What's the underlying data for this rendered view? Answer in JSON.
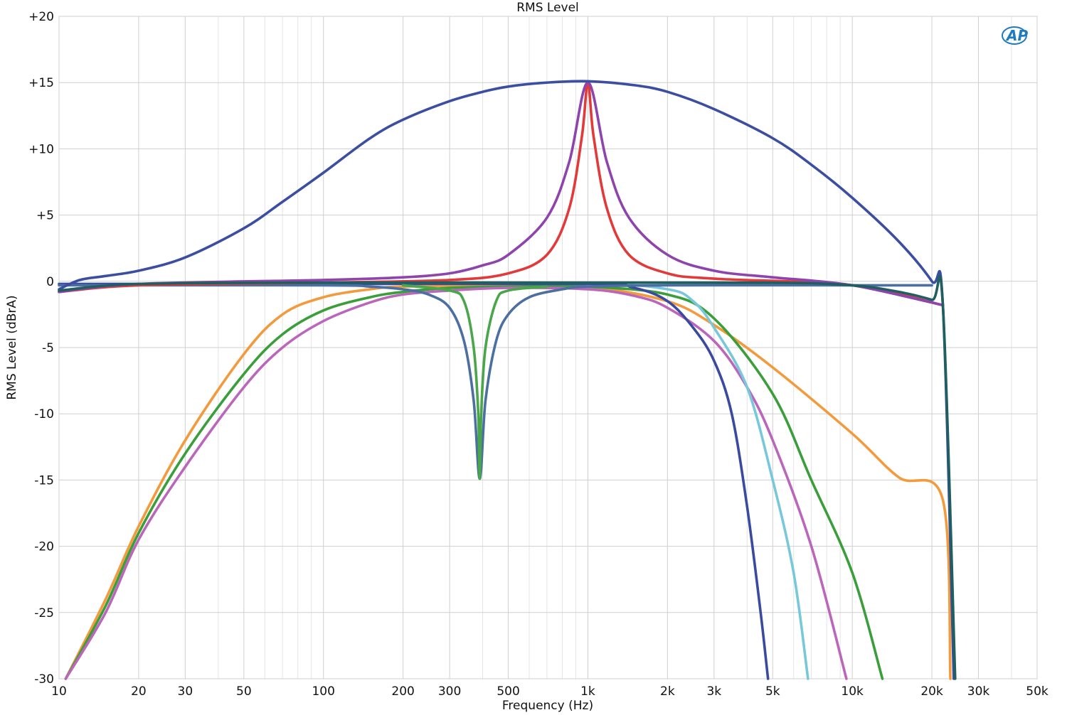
{
  "chart_data": {
    "type": "line",
    "title": "RMS Level",
    "xlabel": "Frequency (Hz)",
    "ylabel": "RMS Level (dBrA)",
    "x_scale": "log",
    "xlim": [
      10,
      50000
    ],
    "ylim": [
      -30,
      20
    ],
    "x_ticks": [
      10,
      20,
      30,
      50,
      100,
      200,
      300,
      500,
      1000,
      2000,
      3000,
      5000,
      10000,
      20000,
      30000,
      50000
    ],
    "x_tick_labels": [
      "10",
      "20",
      "30",
      "50",
      "100",
      "200",
      "300",
      "500",
      "1k",
      "2k",
      "3k",
      "5k",
      "10k",
      "20k",
      "30k",
      "50k"
    ],
    "y_ticks": [
      20,
      15,
      10,
      5,
      0,
      -5,
      -10,
      -15,
      -20,
      -25,
      -30
    ],
    "y_tick_labels": [
      "+20",
      "+15",
      "+10",
      "+5",
      "0",
      "-5",
      "-10",
      "-15",
      "-20",
      "-25",
      "-30"
    ],
    "grid": true,
    "logo": "AP",
    "series": [
      {
        "color": "#f39a3c",
        "points": [
          [
            10.6,
            -30
          ],
          [
            15,
            -24
          ],
          [
            20,
            -18.5
          ],
          [
            30,
            -12
          ],
          [
            50,
            -5.5
          ],
          [
            70,
            -2.5
          ],
          [
            100,
            -1.2
          ],
          [
            150,
            -0.6
          ],
          [
            200,
            -0.4
          ],
          [
            500,
            -0.3
          ],
          [
            1000,
            -0.4
          ],
          [
            2000,
            -1.5
          ],
          [
            3000,
            -3.3
          ],
          [
            5000,
            -6.5
          ],
          [
            10000,
            -11.5
          ],
          [
            15000,
            -14.8
          ],
          [
            22000,
            -16.5
          ],
          [
            23500,
            -30
          ]
        ]
      },
      {
        "color": "#3a9e3a",
        "points": [
          [
            10.6,
            -30
          ],
          [
            15,
            -24.5
          ],
          [
            20,
            -19
          ],
          [
            30,
            -13
          ],
          [
            50,
            -7
          ],
          [
            70,
            -4
          ],
          [
            100,
            -2.2
          ],
          [
            150,
            -1.2
          ],
          [
            200,
            -0.8
          ],
          [
            300,
            -0.5
          ],
          [
            500,
            -0.4
          ],
          [
            1000,
            -0.4
          ],
          [
            2000,
            -1
          ],
          [
            3000,
            -2.8
          ],
          [
            5000,
            -8.5
          ],
          [
            7000,
            -15
          ],
          [
            10000,
            -22
          ],
          [
            13000,
            -30
          ]
        ]
      },
      {
        "color": "#bb66bb",
        "points": [
          [
            10.6,
            -30
          ],
          [
            15,
            -25
          ],
          [
            20,
            -19.5
          ],
          [
            30,
            -14
          ],
          [
            50,
            -8
          ],
          [
            70,
            -5
          ],
          [
            100,
            -3
          ],
          [
            150,
            -1.6
          ],
          [
            200,
            -1
          ],
          [
            300,
            -0.7
          ],
          [
            500,
            -0.5
          ],
          [
            1000,
            -0.6
          ],
          [
            1500,
            -1.1
          ],
          [
            2000,
            -2
          ],
          [
            3000,
            -4.5
          ],
          [
            4000,
            -8
          ],
          [
            5000,
            -12
          ],
          [
            7000,
            -20
          ],
          [
            9500,
            -30
          ]
        ]
      },
      {
        "color": "#78c8dc",
        "points": [
          [
            10,
            -0.2
          ],
          [
            100,
            -0.2
          ],
          [
            1000,
            -0.2
          ],
          [
            2000,
            -0.6
          ],
          [
            2500,
            -1.5
          ],
          [
            3000,
            -3.5
          ],
          [
            4000,
            -8
          ],
          [
            5000,
            -15
          ],
          [
            6000,
            -22
          ],
          [
            6800,
            -30
          ]
        ]
      },
      {
        "color": "#3a4aa0",
        "points": [
          [
            10,
            -0.2
          ],
          [
            100,
            -0.2
          ],
          [
            1000,
            -0.2
          ],
          [
            1500,
            -0.5
          ],
          [
            2000,
            -1.5
          ],
          [
            2500,
            -3.5
          ],
          [
            3000,
            -6
          ],
          [
            3500,
            -10
          ],
          [
            4000,
            -17
          ],
          [
            4500,
            -25
          ],
          [
            4800,
            -30
          ]
        ]
      },
      {
        "color": "#4a6fa0",
        "points": [
          [
            10,
            -0.3
          ],
          [
            100,
            -0.3
          ],
          [
            150,
            -0.4
          ],
          [
            200,
            -0.6
          ],
          [
            250,
            -1
          ],
          [
            300,
            -2
          ],
          [
            340,
            -4.5
          ],
          [
            370,
            -9
          ],
          [
            390,
            -14.9
          ],
          [
            410,
            -9
          ],
          [
            450,
            -4.5
          ],
          [
            500,
            -2.5
          ],
          [
            600,
            -1.2
          ],
          [
            800,
            -0.6
          ],
          [
            1000,
            -0.4
          ],
          [
            2000,
            -0.3
          ],
          [
            10000,
            -0.3
          ],
          [
            20000,
            -0.3
          ]
        ]
      },
      {
        "color": "#4aa64a",
        "points": [
          [
            200,
            -0.3
          ],
          [
            300,
            -0.7
          ],
          [
            340,
            -1.5
          ],
          [
            370,
            -5
          ],
          [
            385,
            -10
          ],
          [
            390,
            -14.9
          ],
          [
            395,
            -10
          ],
          [
            410,
            -5
          ],
          [
            450,
            -1.5
          ],
          [
            500,
            -0.7
          ],
          [
            700,
            -0.4
          ]
        ]
      },
      {
        "color": "#e23a3a",
        "points": [
          [
            10,
            -0.8
          ],
          [
            20,
            -0.3
          ],
          [
            100,
            -0.1
          ],
          [
            300,
            0.1
          ],
          [
            500,
            0.6
          ],
          [
            700,
            2
          ],
          [
            850,
            5.5
          ],
          [
            950,
            11
          ],
          [
            1000,
            15
          ],
          [
            1050,
            11
          ],
          [
            1180,
            5.5
          ],
          [
            1430,
            2
          ],
          [
            2000,
            0.6
          ],
          [
            3000,
            0.2
          ],
          [
            10000,
            -0.3
          ],
          [
            22000,
            -1.8
          ]
        ]
      },
      {
        "color": "#8e44ad",
        "points": [
          [
            10,
            -0.8
          ],
          [
            20,
            -0.2
          ],
          [
            100,
            0.1
          ],
          [
            200,
            0.3
          ],
          [
            300,
            0.6
          ],
          [
            400,
            1.2
          ],
          [
            500,
            2
          ],
          [
            700,
            4.8
          ],
          [
            850,
            9
          ],
          [
            1000,
            15
          ],
          [
            1180,
            9
          ],
          [
            1430,
            4.8
          ],
          [
            2000,
            2
          ],
          [
            3000,
            0.8
          ],
          [
            5000,
            0.3
          ],
          [
            10000,
            -0.3
          ],
          [
            22000,
            -1.8
          ]
        ]
      },
      {
        "color": "#3b4ea1",
        "points": [
          [
            10,
            -0.6
          ],
          [
            12,
            0.1
          ],
          [
            15,
            0.4
          ],
          [
            20,
            0.8
          ],
          [
            30,
            1.8
          ],
          [
            50,
            4
          ],
          [
            70,
            6
          ],
          [
            100,
            8.2
          ],
          [
            150,
            10.8
          ],
          [
            200,
            12.2
          ],
          [
            300,
            13.6
          ],
          [
            400,
            14.3
          ],
          [
            500,
            14.7
          ],
          [
            700,
            15
          ],
          [
            1000,
            15.1
          ],
          [
            1500,
            14.8
          ],
          [
            2000,
            14.3
          ],
          [
            3000,
            13
          ],
          [
            5000,
            10.8
          ],
          [
            7000,
            8.8
          ],
          [
            10000,
            6.3
          ],
          [
            15000,
            3
          ],
          [
            20000,
            0
          ],
          [
            22000,
            -1.8
          ],
          [
            24200,
            -30
          ]
        ]
      },
      {
        "color": "#1f5f5f",
        "points": [
          [
            10,
            -0.7
          ],
          [
            20,
            -0.2
          ],
          [
            100,
            -0.1
          ],
          [
            1000,
            -0.1
          ],
          [
            5000,
            -0.1
          ],
          [
            10000,
            -0.3
          ],
          [
            15000,
            -0.8
          ],
          [
            20000,
            -1.4
          ],
          [
            22000,
            -1.8
          ],
          [
            24500,
            -30
          ]
        ]
      }
    ]
  }
}
